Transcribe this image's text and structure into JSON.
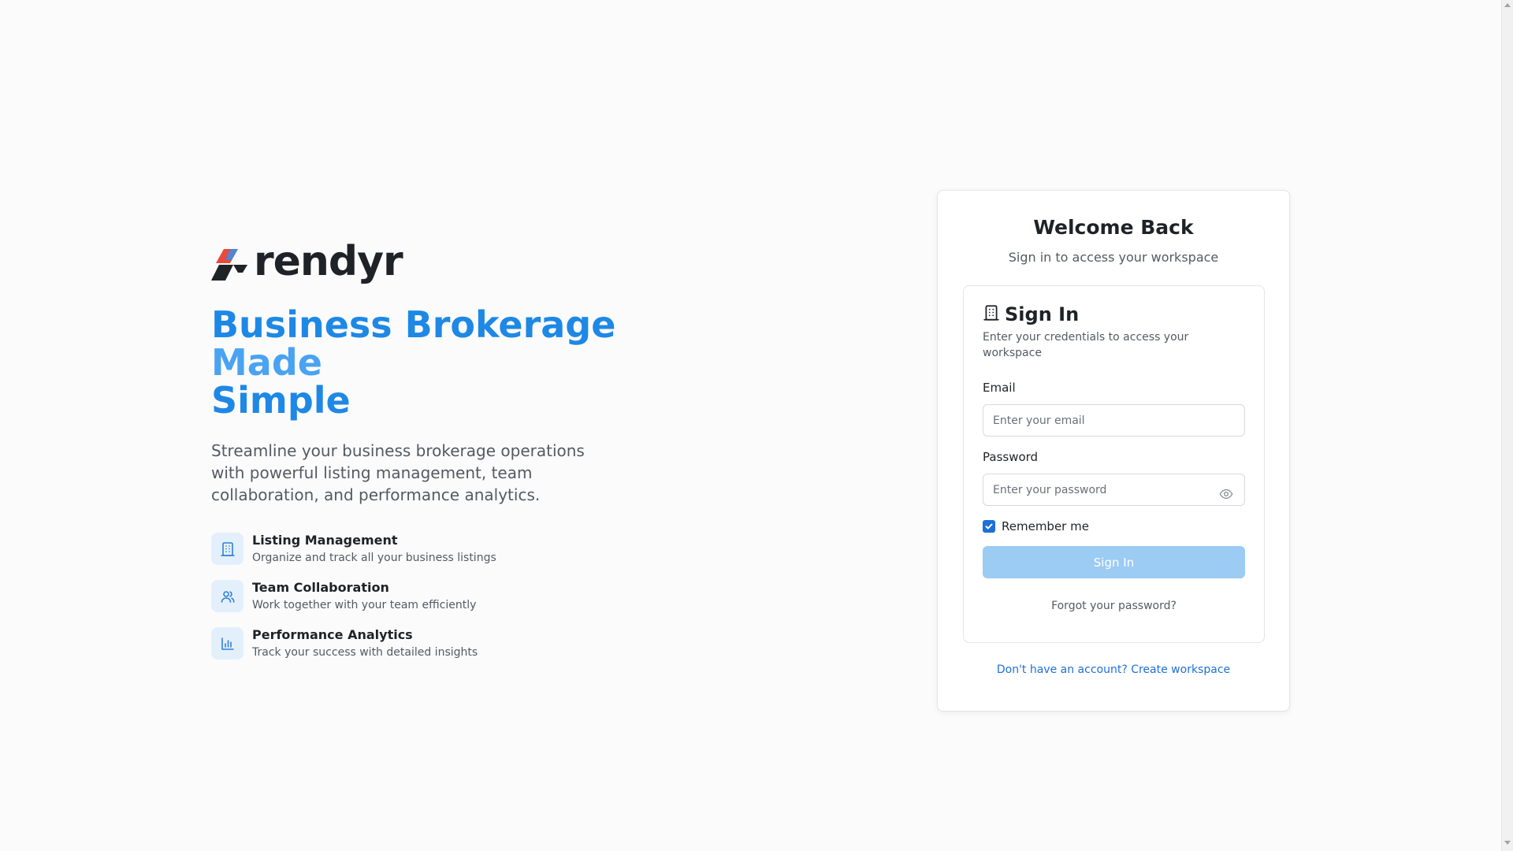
{
  "brand": {
    "name": "rendyr",
    "logo_icon": "rendyr-logo-mark",
    "colors": {
      "dark": "#1f2227",
      "red": "#e84a3c",
      "blue": "#3a8ee6"
    }
  },
  "hero": {
    "headline_part1": "Business Brokerage",
    "headline_part2": "Made",
    "headline_part3": "Simple",
    "tagline": "Streamline your business brokerage operations with powerful listing management, team collaboration, and performance analytics.",
    "features": [
      {
        "icon": "building-icon",
        "title": "Listing Management",
        "description": "Organize and track all your business listings"
      },
      {
        "icon": "users-icon",
        "title": "Team Collaboration",
        "description": "Work together with your team efficiently"
      },
      {
        "icon": "bar-chart-icon",
        "title": "Performance Analytics",
        "description": "Track your success with detailed insights"
      }
    ]
  },
  "card": {
    "title": "Welcome Back",
    "subtitle": "Sign in to access your workspace",
    "form": {
      "title": "Sign In",
      "title_icon": "building-icon",
      "description": "Enter your credentials to access your workspace",
      "email_label": "Email",
      "email_placeholder": "Enter your email",
      "email_value": "",
      "password_label": "Password",
      "password_placeholder": "Enter your password",
      "password_value": "",
      "password_toggle_icon": "eye-icon",
      "remember_label": "Remember me",
      "remember_checked": true,
      "submit_label": "Sign In",
      "forgot_label": "Forgot your password?"
    },
    "create_link": "Don't have an account? Create workspace"
  },
  "theme": {
    "accent": "#1e88e5",
    "accent_light": "#4aa3f0",
    "button_disabled": "#9ccbf4",
    "link": "#1e6fd9"
  }
}
